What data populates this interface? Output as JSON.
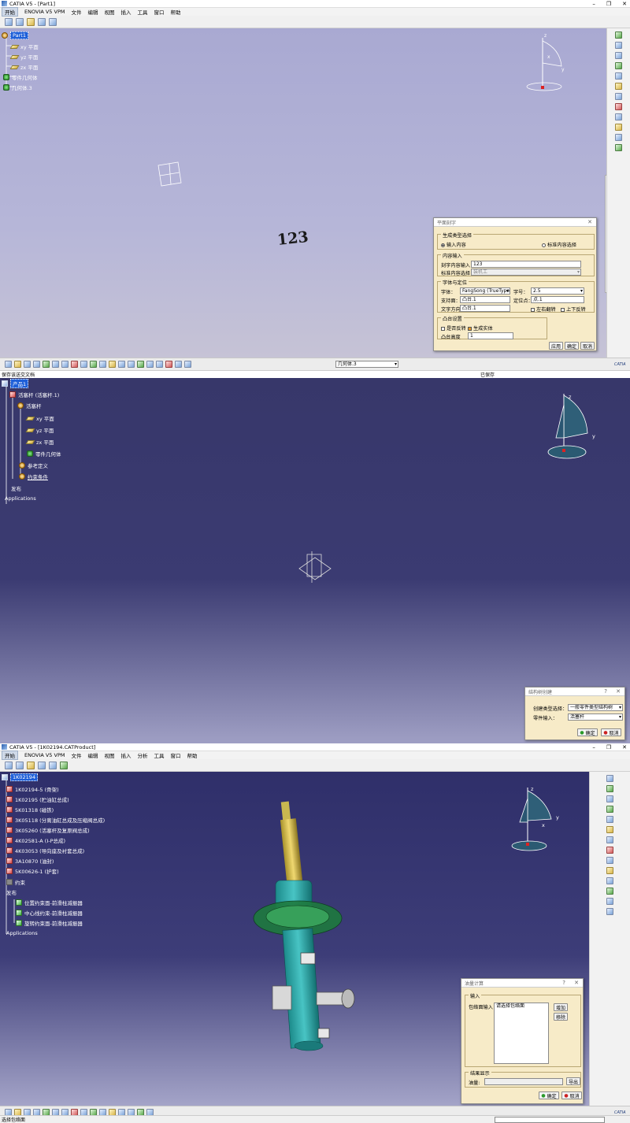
{
  "window1": {
    "title": "CATIA V5 - [Part1]",
    "menu": [
      "开始",
      "ENOVIA V5 VPM",
      "文件",
      "编辑",
      "视图",
      "插入",
      "工具",
      "窗口",
      "帮助"
    ],
    "tree": {
      "root": "Part1",
      "items": [
        "xy 平面",
        "yz 平面",
        "zx 平面",
        "零件几何体",
        "几何体.3"
      ]
    },
    "canvas_text": "123",
    "compass": {
      "x": "x",
      "y": "y",
      "z": "z"
    },
    "dialog": {
      "title": "平面刻字",
      "section_type": "生成类型选择",
      "radio_input": "输入内容",
      "radio_std": "标准内容选择",
      "section_content": "内容输入",
      "label_engrave": "刻字内容输入",
      "engrave_value": "123",
      "label_std": "标准内容选择",
      "std_value": "装机工",
      "section_font": "字体与定位",
      "label_font": "字体：",
      "font_value": "FangSong (TrueType)",
      "label_size": "字号：",
      "size_value": "2.5",
      "label_support": "支持面：",
      "support_value": "凸台.1",
      "label_anchor": "定位点：",
      "anchor_value": "点.1",
      "label_dir": "文字方向",
      "dir_value": "凸台.1",
      "chk_lr": "左右翻转",
      "chk_ud": "上下反转",
      "section_boss": "凸台设置",
      "chk_reverse": "是否反转",
      "chk_solid": "生成实体",
      "label_height": "凸台高度",
      "height_value": "1",
      "btn_apply": "应用",
      "btn_ok": "确定",
      "btn_cancel": "取消"
    },
    "bottom_select": "几何体.3",
    "brand": "CATIA"
  },
  "window2": {
    "header_text": "保存该送交文档",
    "right_label": "已保存",
    "tree": {
      "root": "产品1",
      "part": "活塞杆 (活塞杆.1)",
      "sub": "活塞杆",
      "items": [
        "xy 平面",
        "yz 平面",
        "zx 平面",
        "零件几何体",
        "参考定义",
        "约束条件"
      ],
      "pub": "发布",
      "apps": "Applications"
    },
    "compass": {
      "y": "y",
      "z": "z"
    },
    "dialog": {
      "title": "结构树创建",
      "label_type": "创建类型选择：",
      "type_value": "一般零件类型结构树",
      "label_part": "零件输入：",
      "part_value": "活塞杆",
      "btn_ok": "确定",
      "btn_cancel": "取消"
    }
  },
  "window3": {
    "title": "CATIA V5 - [1K02194.CATProduct]",
    "menu": [
      "开始",
      "ENOVIA V5 VPM",
      "文件",
      "编辑",
      "视图",
      "插入",
      "分析",
      "工具",
      "窗口",
      "帮助"
    ],
    "tree": {
      "root": "1K02194",
      "items": [
        "1K02194-5 (骨架)",
        "1K02195 (贮油缸总成)",
        "5K01318 (磁铁)",
        "3K05118 (分离油缸总成及压缩阀总成)",
        "3K05260 (活塞杆及复原阀总成)",
        "4K02581-A (I-P总成)",
        "4K03053 (导向座及衬套总成)",
        "3A10870 (油封)",
        "5K00626-1 (护套)"
      ],
      "constraint": "约束",
      "pub": "发布",
      "pub_items": [
        "位置约束面-前滑柱减振器",
        "中心线约束-前滑柱减振器",
        "旋转约束面-前滑柱减振器"
      ],
      "apps": "Applications"
    },
    "compass": {
      "x": "x",
      "y": "y",
      "z": "z"
    },
    "dialog": {
      "title": "油量计算",
      "section_input": "输入",
      "label_envelope": "包络面输入：",
      "envelope_value": "请选择包络面",
      "btn_add": "增加",
      "btn_remove": "移除",
      "section_result": "结果显示",
      "label_volume": "油量:",
      "btn_export": "导出",
      "btn_ok": "确定",
      "btn_cancel": "取消"
    },
    "status": "选择包络面",
    "brand": "CATIA"
  }
}
